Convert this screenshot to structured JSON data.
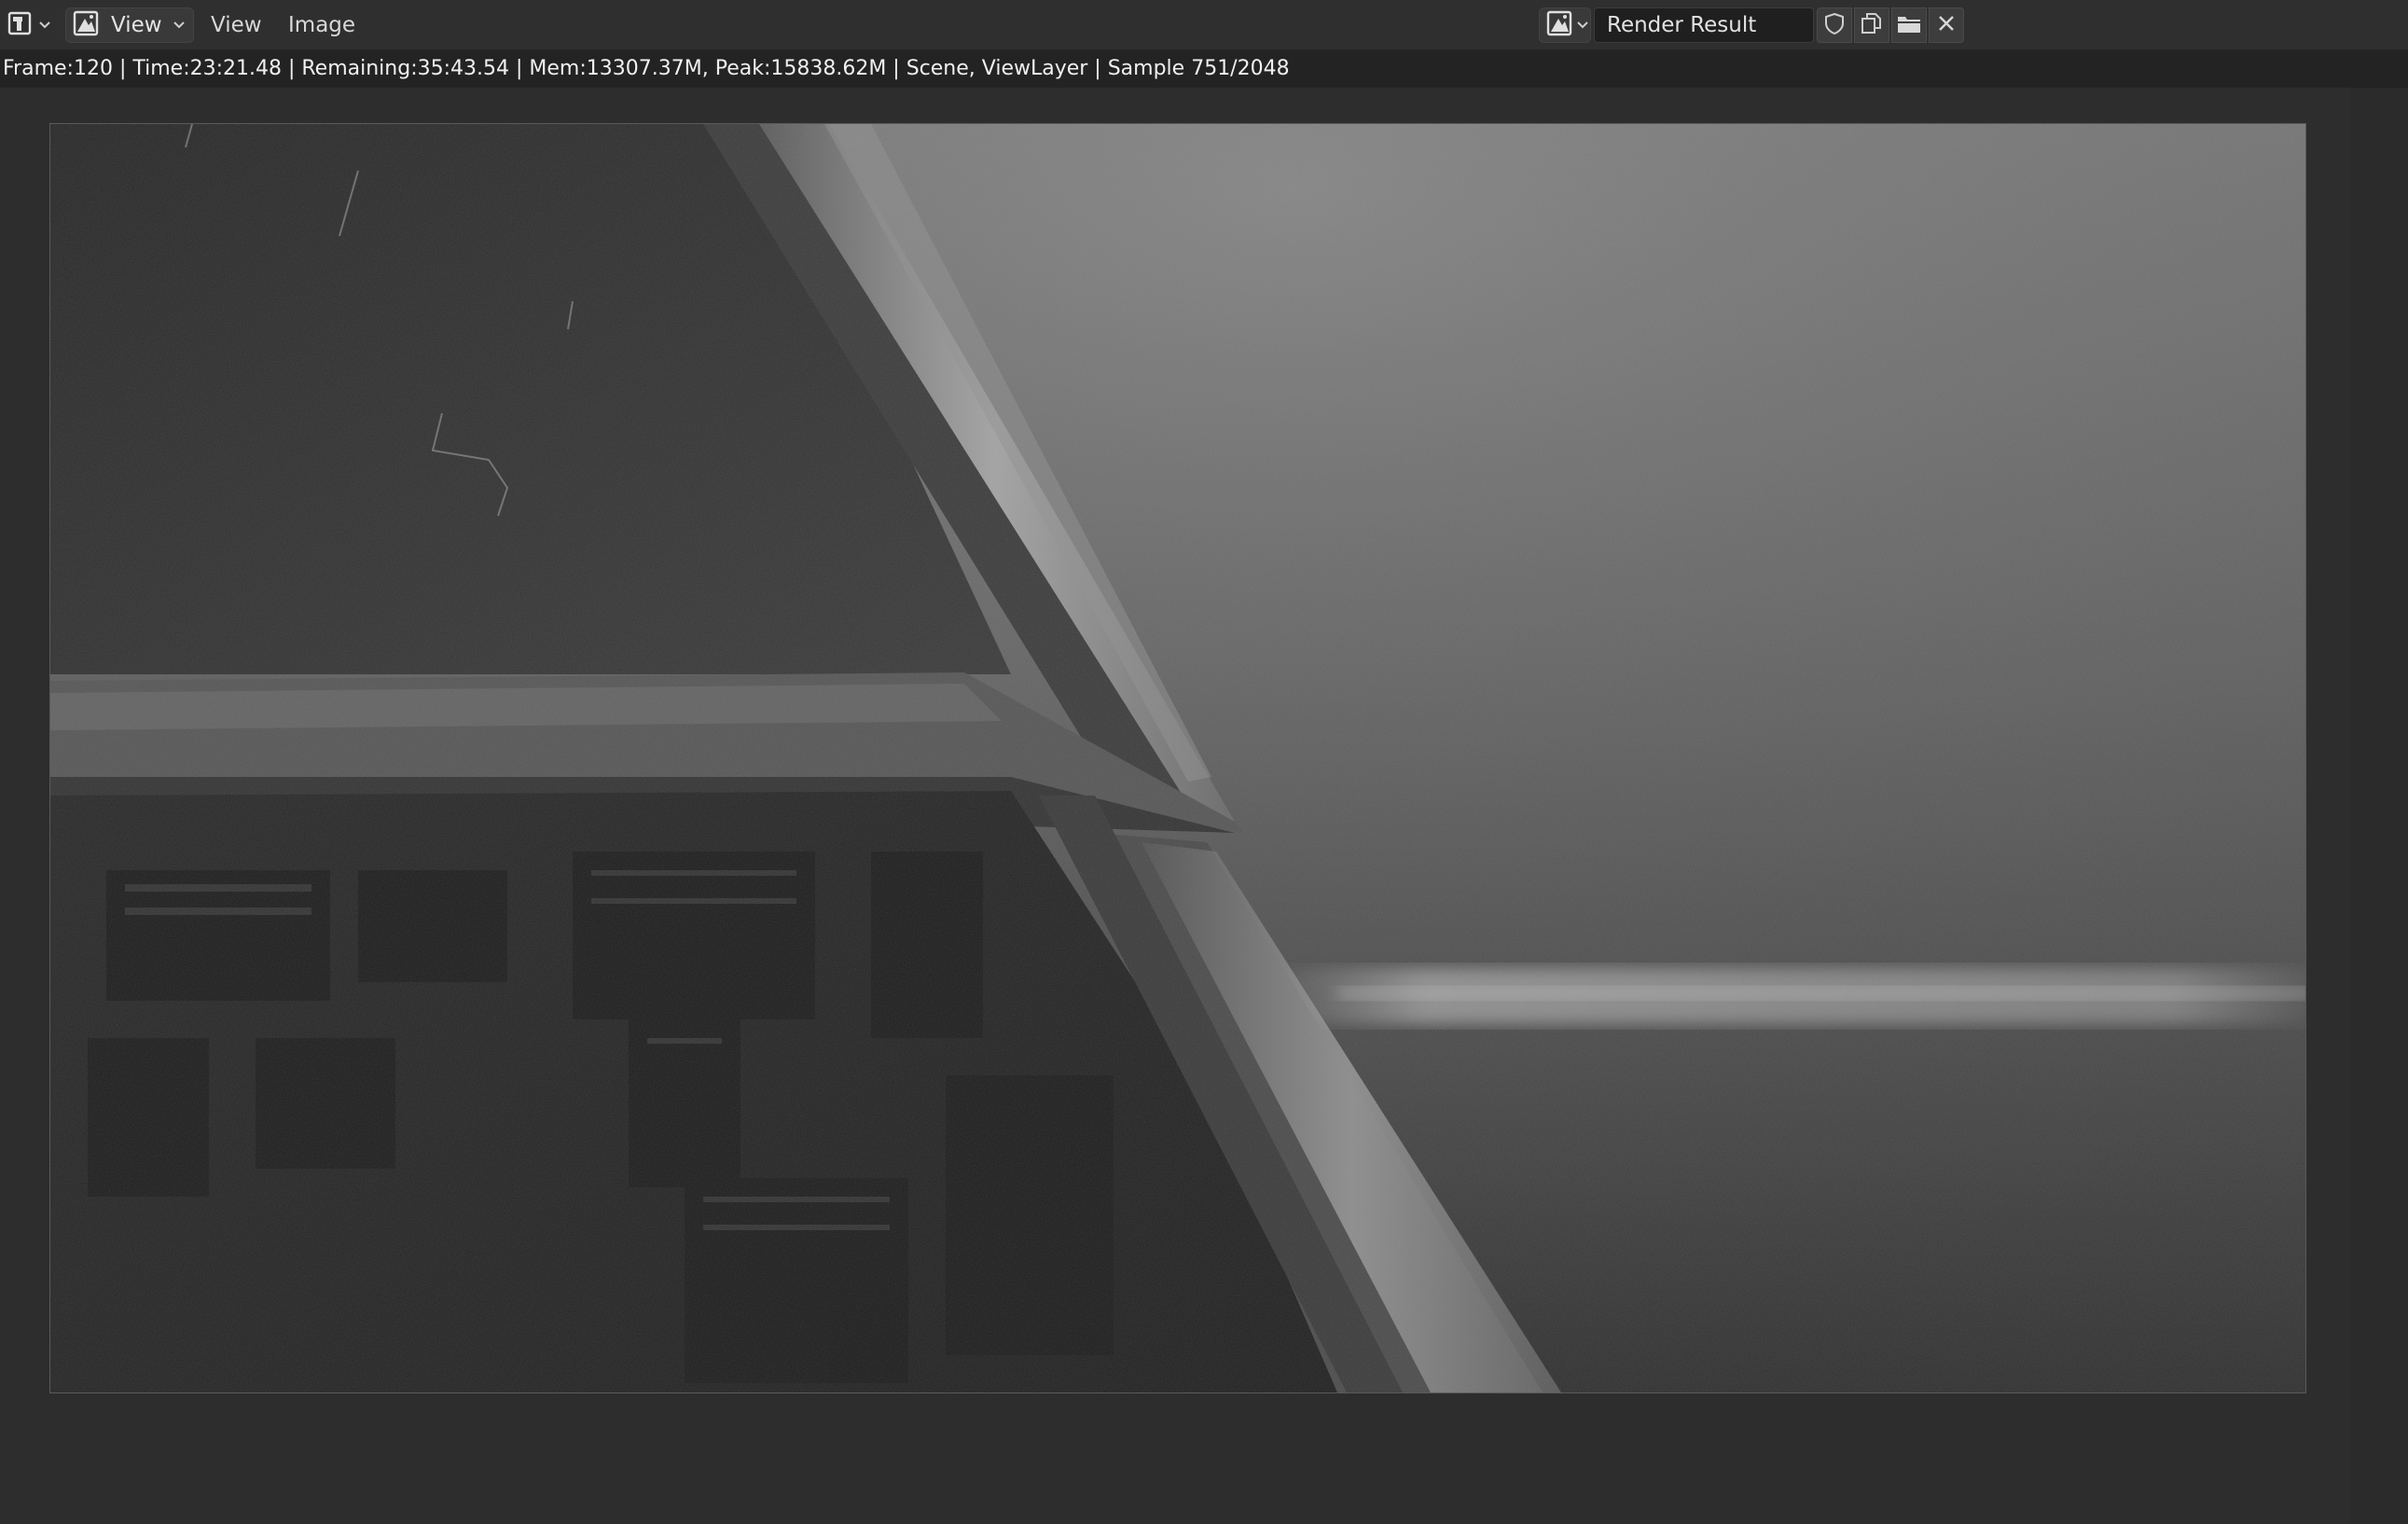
{
  "header": {
    "editor_type_icon": "image-editor-icon",
    "view_mode_icon": "image-view-icon",
    "view_mode_label": "View",
    "menus": {
      "view": "View",
      "image": "Image"
    },
    "image_browse_icon": "image-browse-icon",
    "image_name": "Render Result",
    "buttons": {
      "fake_user_icon": "shield-icon",
      "duplicate_icon": "duplicate-icon",
      "open_icon": "folder-icon",
      "unlink_icon": "close-icon"
    }
  },
  "status": {
    "text": "Frame:120 | Time:23:21.48 | Remaining:35:43.54 | Mem:13307.37M, Peak:15838.62M | Scene, ViewLayer | Sample 751/2048"
  },
  "render": {
    "description_icon": "render-image",
    "colors": {
      "sky_top": "#7a7a7a",
      "sky_mid": "#5e5e5e",
      "sky_bottom": "#3c3c3c",
      "building_dark": "#2a2a2a",
      "building_edge": "#cfcfcf",
      "horizon_glow": "#9a9a9a"
    }
  },
  "theme": {
    "header_bg": "#2f2f2f",
    "status_bg": "#232323",
    "viewport_bg": "#2d2d2d",
    "text": "#e6e6e6"
  }
}
